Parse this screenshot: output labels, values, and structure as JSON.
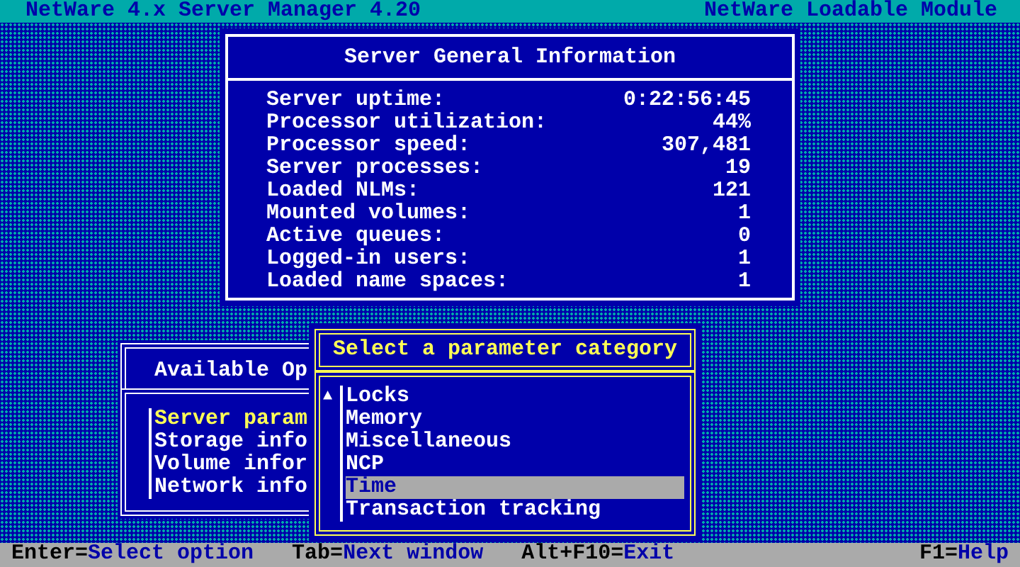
{
  "header": {
    "title": "NetWare 4.x Server Manager  4.20",
    "module": "NetWare Loadable Module"
  },
  "info_window": {
    "title": "Server General Information",
    "rows": [
      {
        "label": "Server uptime:",
        "value": "0:22:56:45"
      },
      {
        "label": "Processor utilization:",
        "value": "44%"
      },
      {
        "label": "Processor speed:",
        "value": "307,481"
      },
      {
        "label": "Server processes:",
        "value": "19"
      },
      {
        "label": "Loaded NLMs:",
        "value": "121"
      },
      {
        "label": "Mounted volumes:",
        "value": "1"
      },
      {
        "label": "Active queues:",
        "value": "0"
      },
      {
        "label": "Logged-in users:",
        "value": "1"
      },
      {
        "label": "Loaded name spaces:",
        "value": "1"
      }
    ]
  },
  "options_window": {
    "title": "Available Op",
    "items": [
      {
        "label": "Server param",
        "selected": true
      },
      {
        "label": "Storage info",
        "selected": false
      },
      {
        "label": "Volume infor",
        "selected": false
      },
      {
        "label": "Network info",
        "selected": false
      }
    ]
  },
  "parameter_window": {
    "title": "Select a parameter category",
    "scroll_indicator": "▲",
    "items": [
      {
        "label": "Locks",
        "selected": false
      },
      {
        "label": "Memory",
        "selected": false
      },
      {
        "label": "Miscellaneous",
        "selected": false
      },
      {
        "label": "NCP",
        "selected": false
      },
      {
        "label": "Time",
        "selected": true
      },
      {
        "label": "Transaction tracking",
        "selected": false
      }
    ]
  },
  "status_bar": [
    {
      "key": "Enter=",
      "action": "Select option"
    },
    {
      "key": "Tab=",
      "action": "Next window"
    },
    {
      "key": "Alt+F10=",
      "action": "Exit"
    },
    {
      "key": "F1=",
      "action": "Help"
    }
  ]
}
